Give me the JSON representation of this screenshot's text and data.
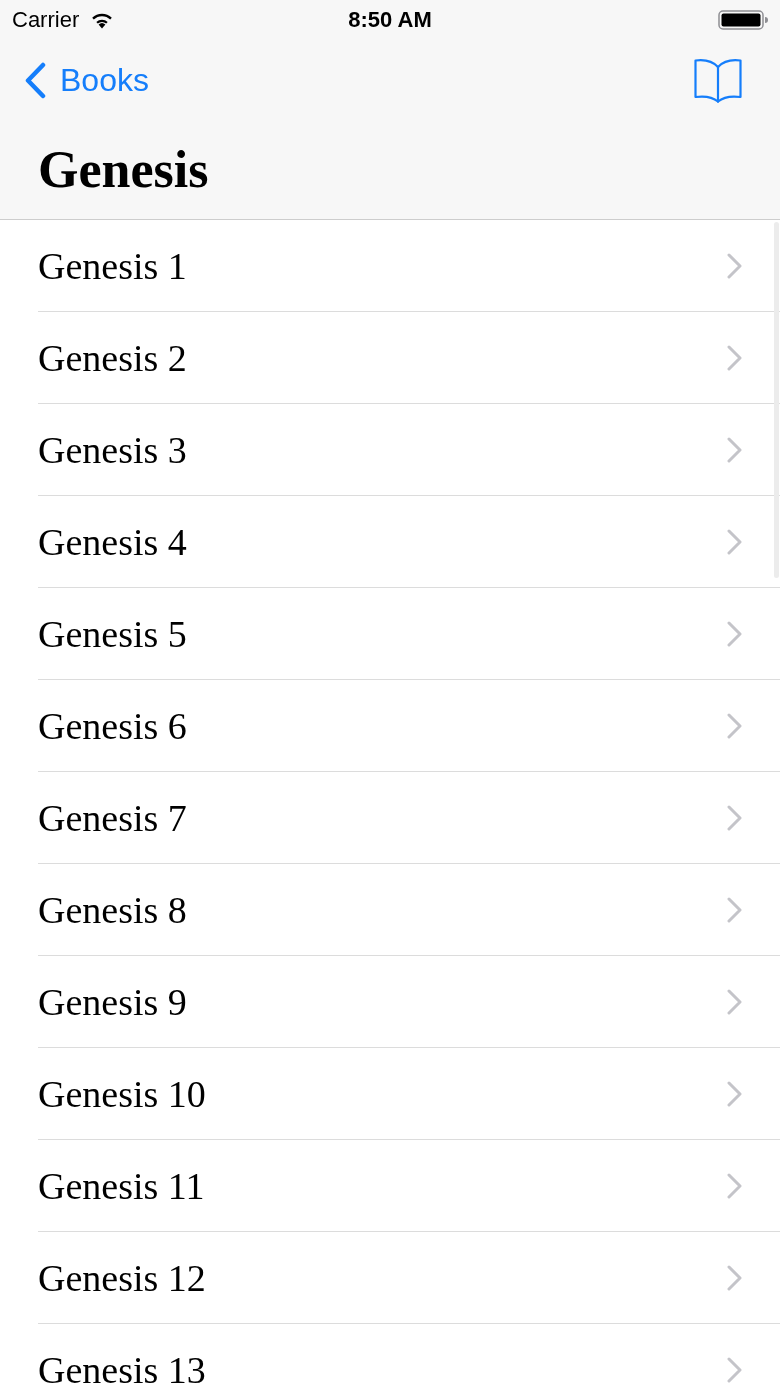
{
  "status_bar": {
    "carrier": "Carrier",
    "time": "8:50 AM"
  },
  "nav_bar": {
    "back_button": "Books",
    "title": "Genesis"
  },
  "chapters": [
    "Genesis 1",
    "Genesis 2",
    "Genesis 3",
    "Genesis 4",
    "Genesis 5",
    "Genesis 6",
    "Genesis 7",
    "Genesis 8",
    "Genesis 9",
    "Genesis 10",
    "Genesis 11",
    "Genesis 12",
    "Genesis 13"
  ]
}
